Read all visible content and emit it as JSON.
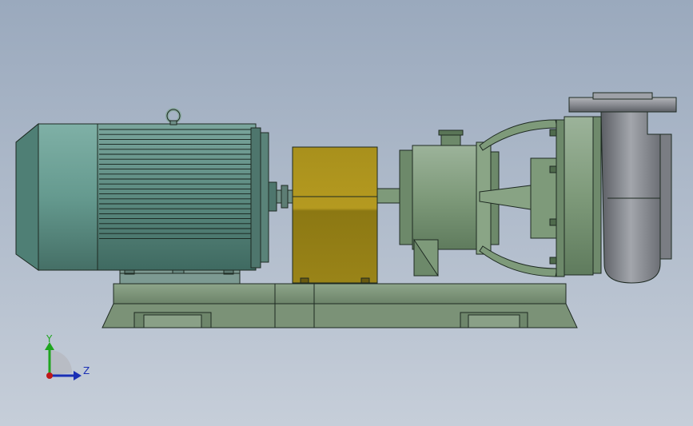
{
  "viewport": {
    "background_top": "#9aa9bd",
    "background_bottom": "#c6ced9"
  },
  "model": {
    "description_parts": [
      "motor",
      "coupling-guard",
      "bearing-housing",
      "pump-casing",
      "baseplate"
    ],
    "colors": {
      "motor_body": "#5e8a80",
      "motor_fan_cover": "#6b9a91",
      "pump_green": "#7e9a7a",
      "coupling_guard": "#9e8a1c",
      "baseplate": "#7b9277",
      "casing_steel": "#8a8c92",
      "outline": "#1e2a22"
    }
  },
  "triad": {
    "y_label": "Y",
    "z_label": "Z",
    "y_color": "#1fa51f",
    "z_color": "#1a2fb5",
    "origin_color": "#c01818"
  }
}
